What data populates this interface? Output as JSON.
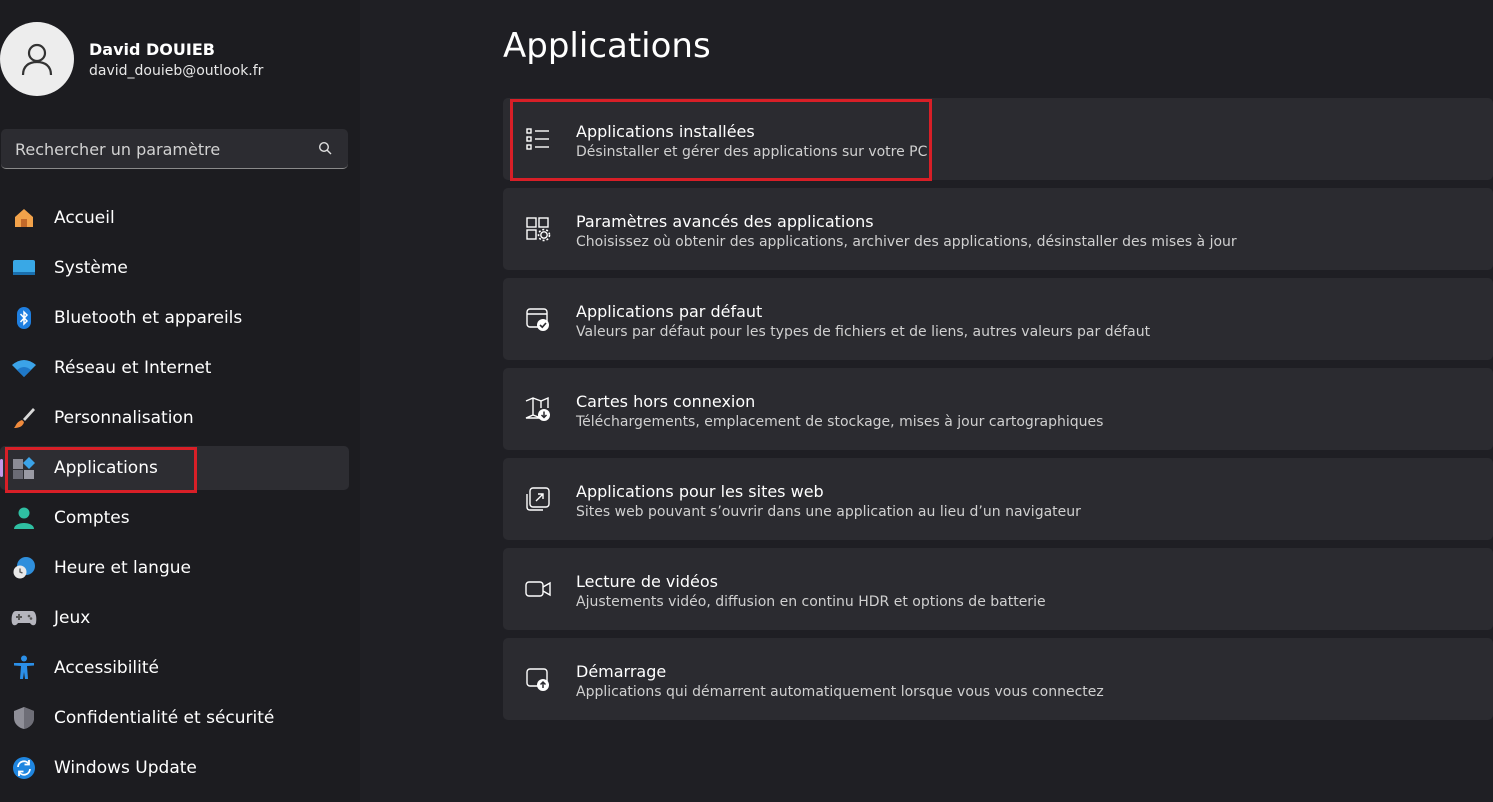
{
  "profile": {
    "name": "David DOUIEB",
    "email": "david_douieb@outlook.fr"
  },
  "search": {
    "placeholder": "Rechercher un paramètre"
  },
  "sidebar": {
    "items": [
      {
        "label": "Accueil",
        "icon": "home-icon"
      },
      {
        "label": "Système",
        "icon": "system-icon"
      },
      {
        "label": "Bluetooth et appareils",
        "icon": "bluetooth-icon"
      },
      {
        "label": "Réseau et Internet",
        "icon": "wifi-icon"
      },
      {
        "label": "Personnalisation",
        "icon": "brush-icon"
      },
      {
        "label": "Applications",
        "icon": "apps-icon",
        "selected": true
      },
      {
        "label": "Comptes",
        "icon": "account-icon"
      },
      {
        "label": "Heure et langue",
        "icon": "clock-globe-icon"
      },
      {
        "label": "Jeux",
        "icon": "gamepad-icon"
      },
      {
        "label": "Accessibilité",
        "icon": "accessibility-icon"
      },
      {
        "label": "Confidentialité et sécurité",
        "icon": "shield-icon"
      },
      {
        "label": "Windows Update",
        "icon": "update-icon"
      }
    ]
  },
  "main": {
    "title": "Applications",
    "cards": [
      {
        "title": "Applications installées",
        "desc": "Désinstaller et gérer des applications sur votre PC",
        "icon": "list-icon"
      },
      {
        "title": "Paramètres avancés des applications",
        "desc": "Choisissez où obtenir des applications, archiver des applications, désinstaller des mises à jour",
        "icon": "apps-gear-icon"
      },
      {
        "title": "Applications par défaut",
        "desc": "Valeurs par défaut pour les types de fichiers et de liens, autres valeurs par défaut",
        "icon": "default-apps-icon"
      },
      {
        "title": "Cartes hors connexion",
        "desc": "Téléchargements, emplacement de stockage, mises à jour cartographiques",
        "icon": "map-download-icon"
      },
      {
        "title": "Applications pour les sites web",
        "desc": "Sites web pouvant s’ouvrir dans une application au lieu d’un navigateur",
        "icon": "web-open-icon"
      },
      {
        "title": "Lecture de vidéos",
        "desc": "Ajustements vidéo, diffusion en continu HDR et options de batterie",
        "icon": "video-camera-icon"
      },
      {
        "title": "Démarrage",
        "desc": "Applications qui démarrent automatiquement lorsque vous vous connectez",
        "icon": "startup-icon"
      }
    ]
  },
  "colors": {
    "background": "#1f1f24",
    "sidebar": "#1c1c20",
    "card": "#2b2b30",
    "highlight": "#d81f27",
    "selected_indicator": "#c39ae8"
  }
}
